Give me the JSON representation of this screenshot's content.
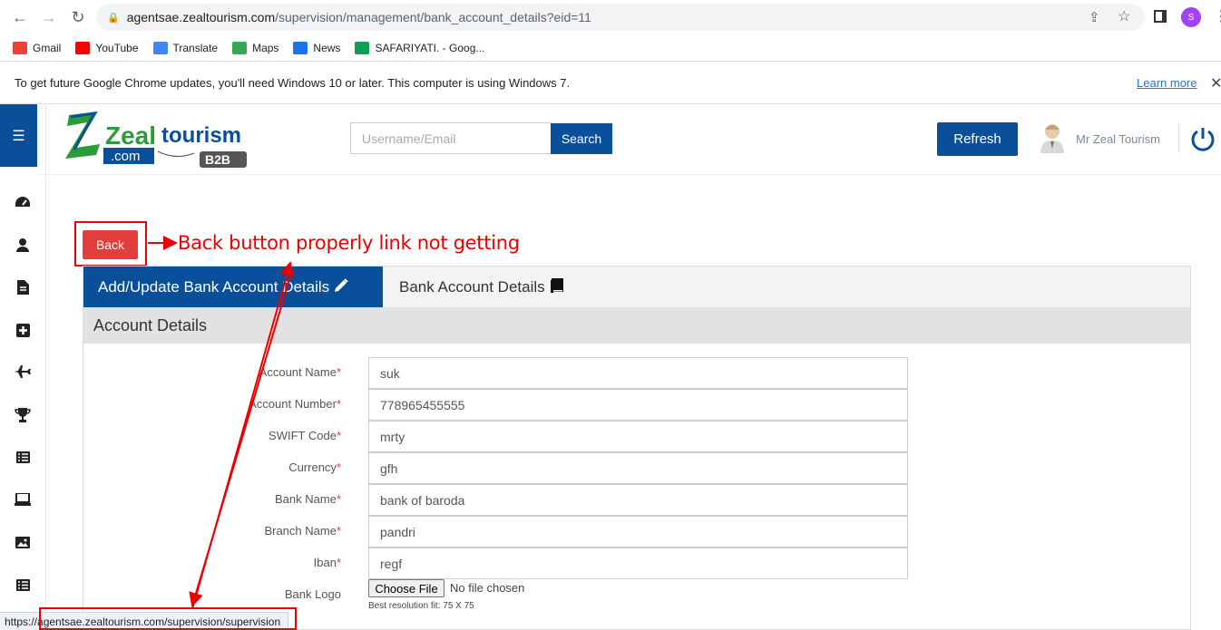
{
  "browser": {
    "url_host": "agentsae.zealtourism.com",
    "url_path": "/supervision/management/bank_account_details?eid=11",
    "profile_initial": "S",
    "bookmarks": [
      {
        "label": "Gmail",
        "color": "#ea4335"
      },
      {
        "label": "YouTube",
        "color": "#ff0000"
      },
      {
        "label": "Translate",
        "color": "#4285f4"
      },
      {
        "label": "Maps",
        "color": "#34a853"
      },
      {
        "label": "News",
        "color": "#1a73e8"
      },
      {
        "label": "SAFARIYATI. - Goog...",
        "color": "#0f9d58"
      }
    ],
    "infobar_text": "To get future Google Chrome updates, you'll need Windows 10 or later. This computer is using Windows 7.",
    "infobar_link": "Learn more",
    "status_url": "https://agentsae.zealtourism.com/supervision/supervision"
  },
  "header": {
    "logo_text": "Zeal tourism",
    "logo_sub": ".com",
    "logo_badge": "B2B",
    "search_placeholder": "Username/Email",
    "search_label": "Search",
    "refresh_label": "Refresh",
    "user_name": "Mr Zeal Tourism",
    "brand_color": "#0a4f9a"
  },
  "sidebar": {
    "icons": [
      "dashboard-icon",
      "user-icon",
      "document-icon",
      "plus-square-icon",
      "plane-icon",
      "trophy-icon",
      "list-icon",
      "laptop-icon",
      "image-icon",
      "list-alt-icon"
    ]
  },
  "page": {
    "back_label": "Back",
    "annotation": "Back button properly link not getting",
    "tabs": [
      {
        "label": "Add/Update Bank Account Details",
        "active": true
      },
      {
        "label": "Bank Account Details",
        "active": false
      }
    ],
    "section_title": "Account Details",
    "fields": [
      {
        "label": "Account Name",
        "value": "suk"
      },
      {
        "label": "Account Number",
        "value": "778965455555"
      },
      {
        "label": "SWIFT Code",
        "value": "mrty"
      },
      {
        "label": "Currency",
        "value": "gfh"
      },
      {
        "label": "Bank Name",
        "value": "bank of baroda"
      },
      {
        "label": "Branch Name",
        "value": "pandri"
      },
      {
        "label": "Iban",
        "value": "regf"
      }
    ],
    "logo_field_label": "Bank Logo",
    "file_button": "Choose File",
    "file_status": "No file chosen",
    "file_hint": "Best resolution fit: 75 X 75",
    "required_mark": "*"
  }
}
